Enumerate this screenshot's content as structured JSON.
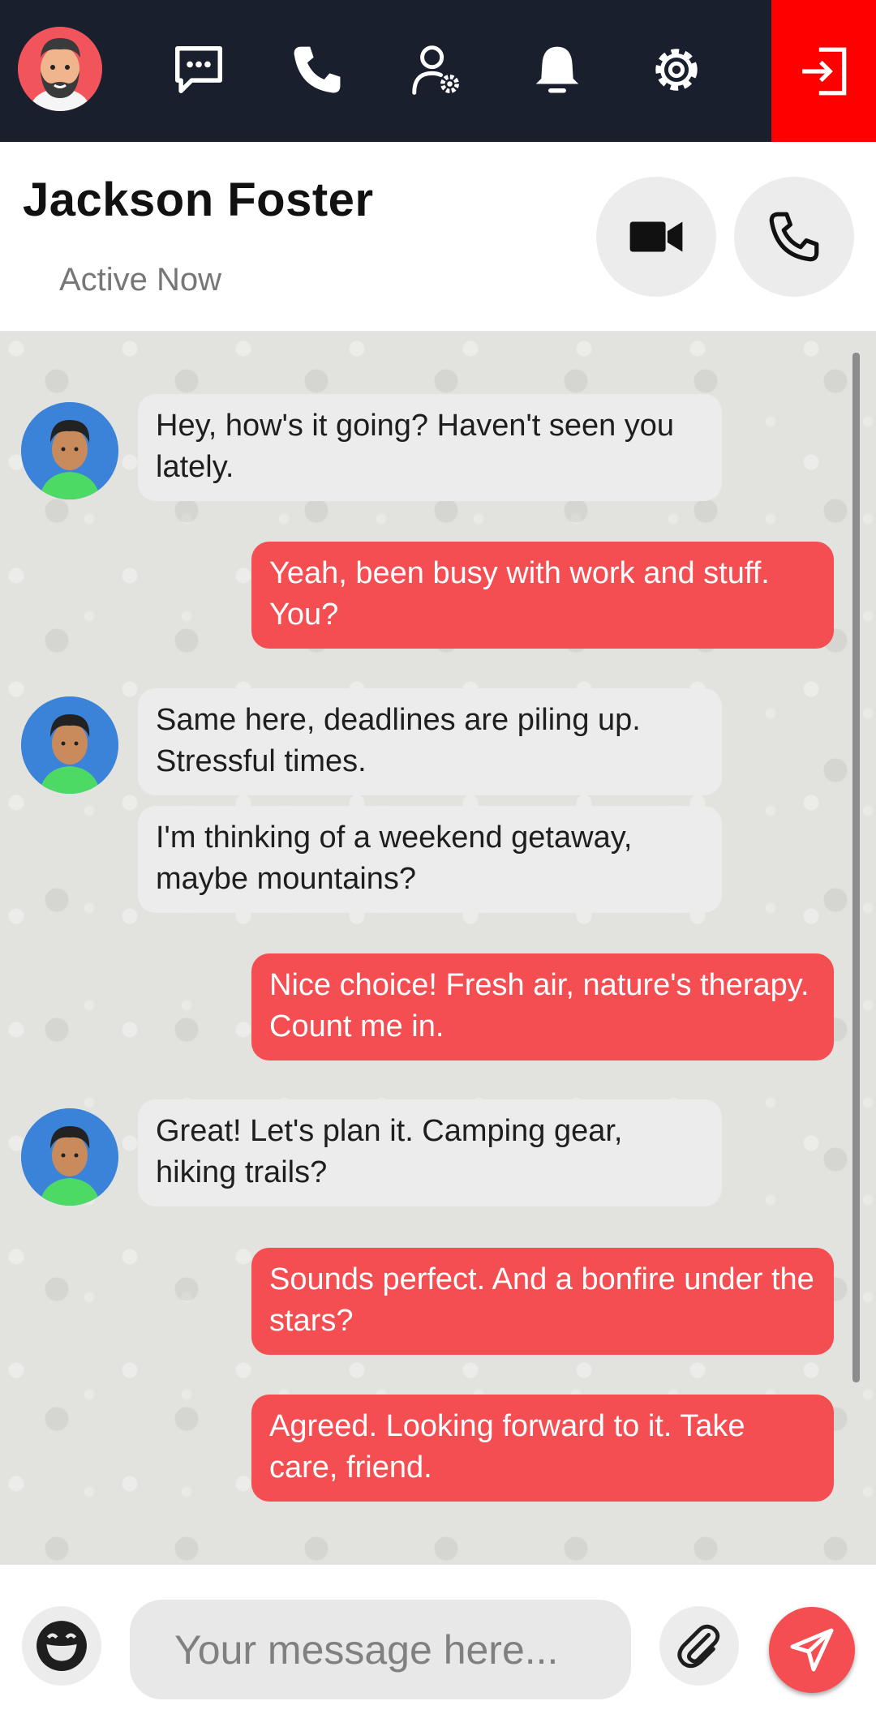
{
  "nav": {
    "items": [
      {
        "name": "chat-icon"
      },
      {
        "name": "phone-icon"
      },
      {
        "name": "user-settings-icon"
      },
      {
        "name": "bell-icon"
      },
      {
        "name": "gear-icon"
      }
    ],
    "logout_icon": "logout-icon",
    "bg_color": "#1a1f2e",
    "logout_color": "#ff0000"
  },
  "header": {
    "name": "Jackson Foster",
    "status": "Active Now"
  },
  "messages": [
    {
      "direction": "in",
      "avatar": true,
      "text": "Hey, how's it going? Haven't seen you lately."
    },
    {
      "direction": "out",
      "avatar": false,
      "text": "Yeah, been busy with work and stuff. You?"
    },
    {
      "direction": "in",
      "avatar": true,
      "text": "Same here, deadlines are piling up. Stressful times."
    },
    {
      "direction": "in",
      "avatar": false,
      "text": "I'm thinking of a weekend getaway, maybe mountains?"
    },
    {
      "direction": "out",
      "avatar": false,
      "text": "Nice choice! Fresh air, nature's therapy. Count me in."
    },
    {
      "direction": "in",
      "avatar": true,
      "text": "Great! Let's plan it. Camping gear, hiking trails?"
    },
    {
      "direction": "out",
      "avatar": false,
      "text": "Sounds perfect. And a bonfire under the stars?"
    },
    {
      "direction": "out",
      "avatar": false,
      "text": "Agreed. Looking forward to it. Take care, friend."
    }
  ],
  "composer": {
    "placeholder": "Your message here...",
    "accent": "#f44e52"
  }
}
